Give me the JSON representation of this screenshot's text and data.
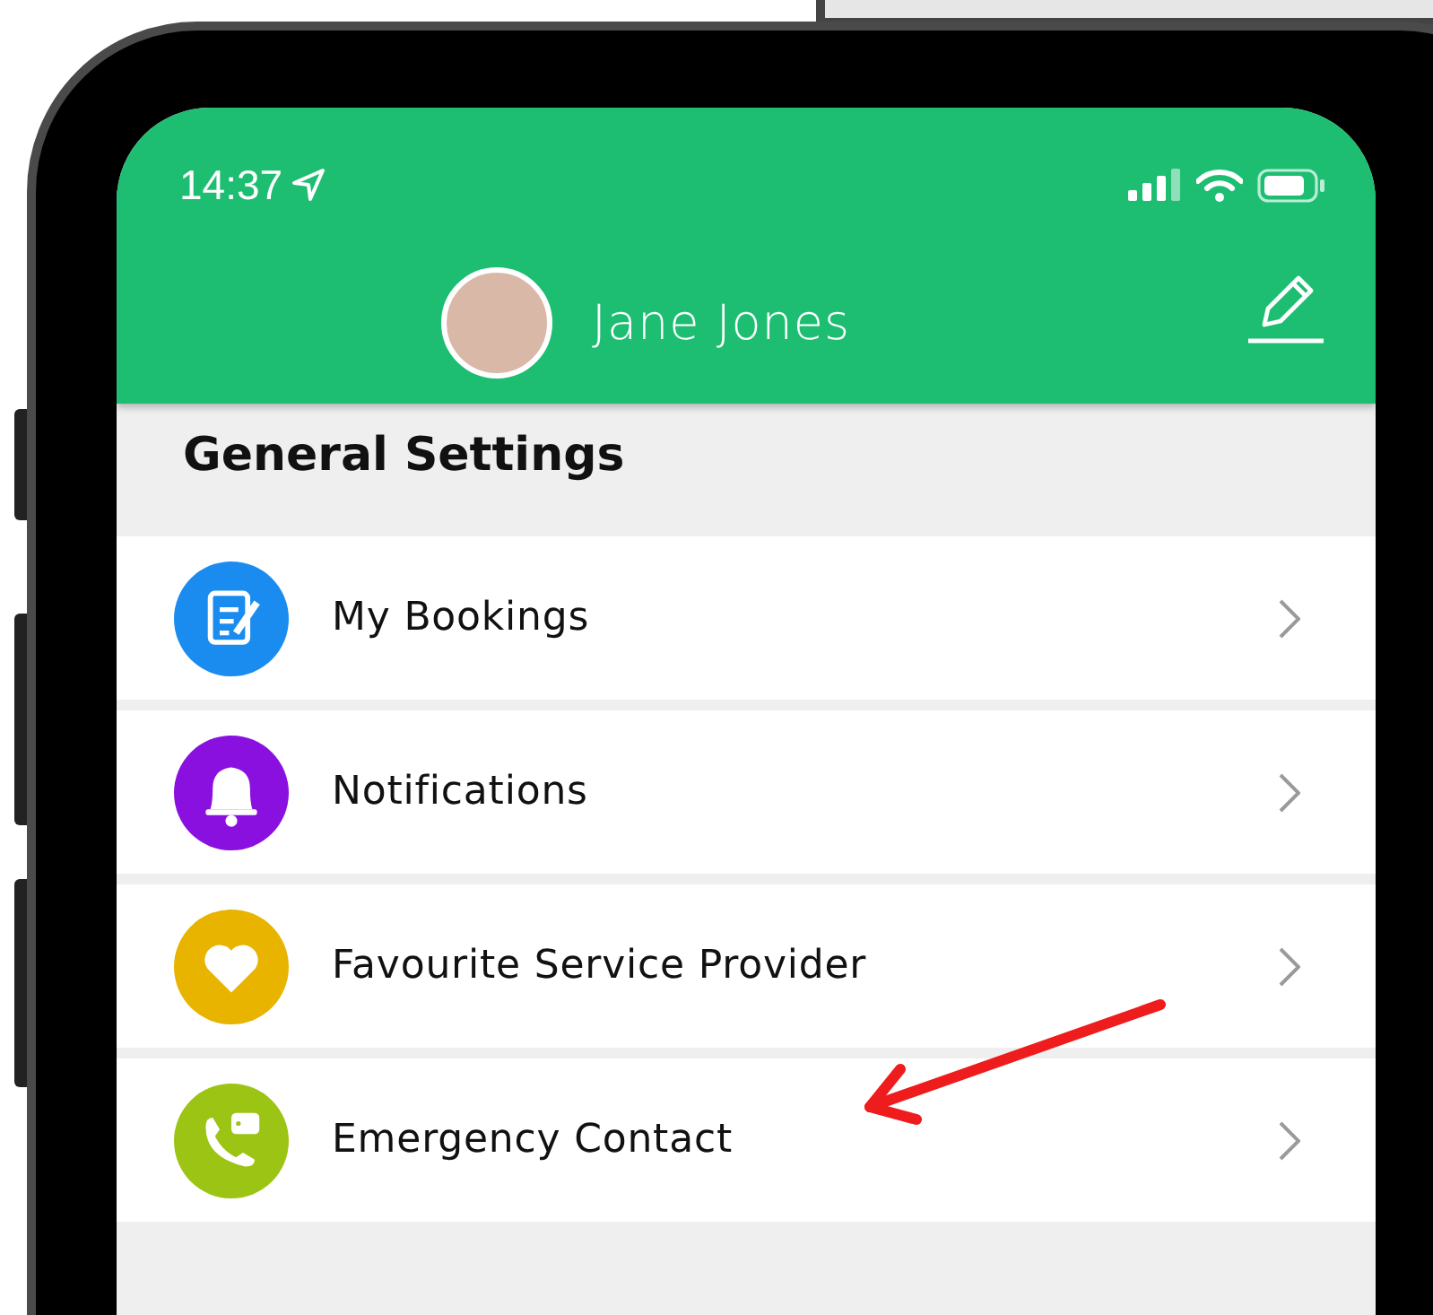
{
  "status_bar": {
    "time": "14:37"
  },
  "profile": {
    "name": "Jane Jones"
  },
  "section": {
    "title": "General Settings"
  },
  "items": [
    {
      "label": "My Bookings",
      "kind": "bookings",
      "color": "#1a8cf0"
    },
    {
      "label": "Notifications",
      "kind": "notifications",
      "color": "#8a10e0"
    },
    {
      "label": "Favourite Service Provider",
      "kind": "favourite",
      "color": "#e8b400"
    },
    {
      "label": "Emergency Contact",
      "kind": "emergency",
      "color": "#9cc414"
    }
  ]
}
